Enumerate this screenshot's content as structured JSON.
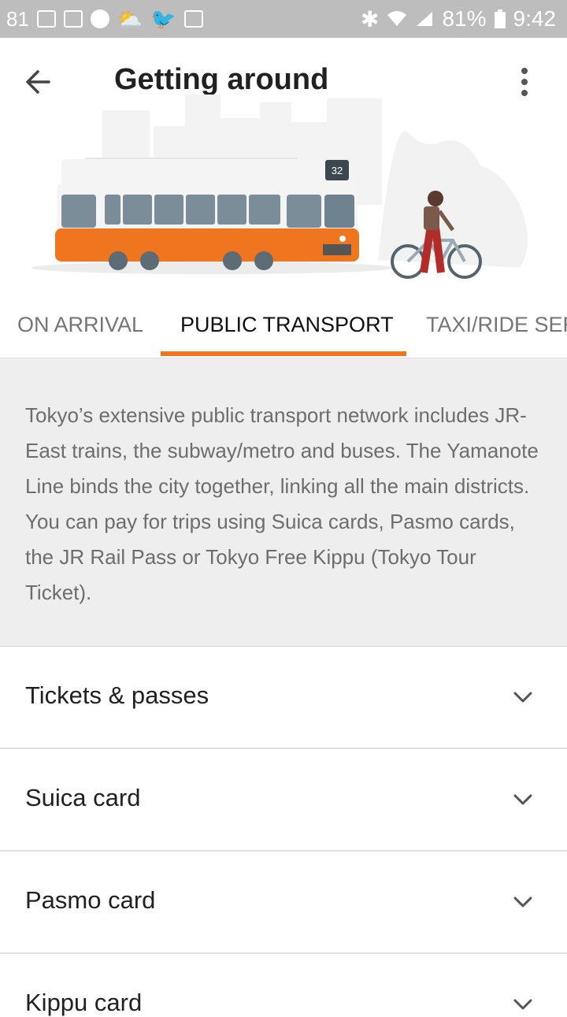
{
  "status_bar": {
    "notification_count": "81",
    "battery_percent": "81%",
    "time": "9:42",
    "icons": [
      "photo-icon",
      "gmail-icon",
      "check-icon",
      "weather-icon",
      "twitter-icon",
      "briefcase-icon",
      "bluetooth-icon",
      "wifi-icon",
      "signal-icon",
      "battery-icon"
    ]
  },
  "app_bar": {
    "title": "Getting around",
    "back_icon": "arrow-back-icon",
    "menu_icon": "more-vert-icon"
  },
  "hero": {
    "tram_number": "32"
  },
  "tabs": [
    {
      "label": "ON ARRIVAL",
      "active": false
    },
    {
      "label": "PUBLIC TRANSPORT",
      "active": true
    },
    {
      "label": "TAXI/RIDE SERVICES",
      "active": false
    }
  ],
  "intro": {
    "text": "Tokyo’s extensive public transport network includes JR-East trains, the subway/metro and buses. The Yamanote Line binds the city together, linking all the main districts. You can pay for trips using Suica cards, Pasmo cards, the JR Rail Pass or Tokyo Free Kippu (Tokyo Tour Ticket)."
  },
  "sections": [
    {
      "label": "Tickets & passes"
    },
    {
      "label": "Suica card"
    },
    {
      "label": "Pasmo card"
    },
    {
      "label": "Kippu card"
    }
  ],
  "colors": {
    "accent": "#f0751f",
    "status_bar": "#bdbdbd",
    "intro_bg": "#eeeeee"
  }
}
